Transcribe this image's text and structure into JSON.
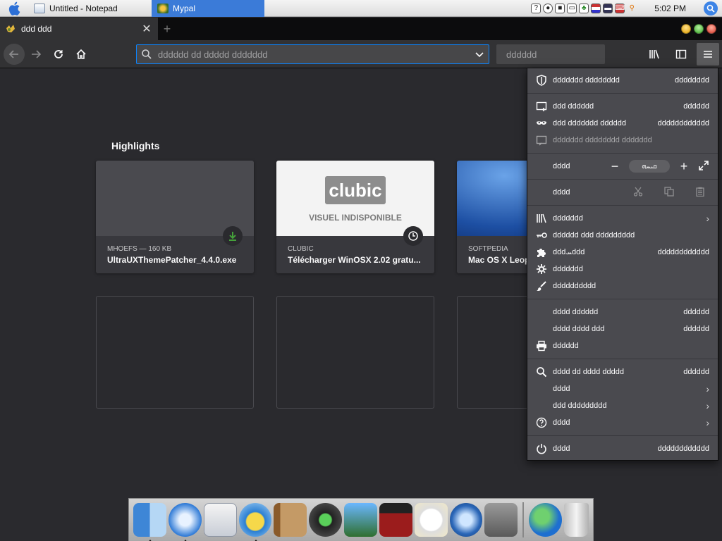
{
  "menubar": {
    "tasks": [
      {
        "label": "Untitled - Notepad",
        "icon": "notepad-icon"
      },
      {
        "label": "Mypal",
        "icon": "mypal-icon"
      }
    ],
    "clock": "5:02 PM"
  },
  "tab": {
    "title": "ddd ddd"
  },
  "toolbar": {
    "url_placeholder": "dddddd dd ddddd ddddddd",
    "search_placeholder": "dddddd"
  },
  "highlights": {
    "title": "Highlights",
    "cards": [
      {
        "meta": "MHOEFS — 160 KB",
        "name": "UltraUXThemePatcher_4.4.0.exe",
        "badge": "download-icon"
      },
      {
        "meta": "CLUBIC",
        "name": "Télécharger WinOSX 2.02 gratu...",
        "badge": "history-icon",
        "thumb_logo": "clubic",
        "thumb_text": "VISUEL INDISPONIBLE"
      },
      {
        "meta": "SOFTPEDIA",
        "name": "Mac OS X Leop"
      }
    ]
  },
  "menu": {
    "items": [
      {
        "label": "ddddddd dddddddd",
        "key": "dddddddd",
        "icon": "shield-icon"
      },
      {
        "label": "ddd dddddd",
        "key": "dddddd",
        "icon": "new-window-icon"
      },
      {
        "label": "ddd ddddddd dddddd",
        "key": "dddddddddddd",
        "icon": "private-mask-icon"
      },
      {
        "label": "ddddddd dddddddd ddddddd",
        "key": "",
        "icon": "restore-session-icon"
      },
      {
        "label": "dddd",
        "zoom": "ܩܝܚܗ"
      },
      {
        "label": "dddd"
      },
      {
        "label": "ddddddd",
        "icon": "library-icon",
        "arrow": "›"
      },
      {
        "label": "dddddd ddd ddddddddd",
        "icon": "key-icon"
      },
      {
        "label": "dddܚddd",
        "key": "dddddddddddd",
        "icon": "puzzle-icon"
      },
      {
        "label": "ddddddd",
        "icon": "gear-icon"
      },
      {
        "label": "dddddddddd",
        "icon": "brush-icon"
      },
      {
        "label": "dddd dddddd",
        "key": "dddddd"
      },
      {
        "label": "dddd dddd ddd",
        "key": "dddddd"
      },
      {
        "label": "dddddd",
        "icon": "print-icon"
      },
      {
        "label": "dddd dd dddd ddddd",
        "key": "dddddd",
        "icon": "search-icon"
      },
      {
        "label": "dddd",
        "arrow": "›"
      },
      {
        "label": "ddd ddddddddd",
        "arrow": "›"
      },
      {
        "label": "dddd",
        "icon": "help-icon",
        "arrow": "›"
      },
      {
        "label": "dddd",
        "key": "dddddddddddd",
        "icon": "power-icon"
      }
    ]
  },
  "colors": {
    "accent": "#0a84ff",
    "panel": "#4a4a4f",
    "content": "#2a2a2e"
  }
}
